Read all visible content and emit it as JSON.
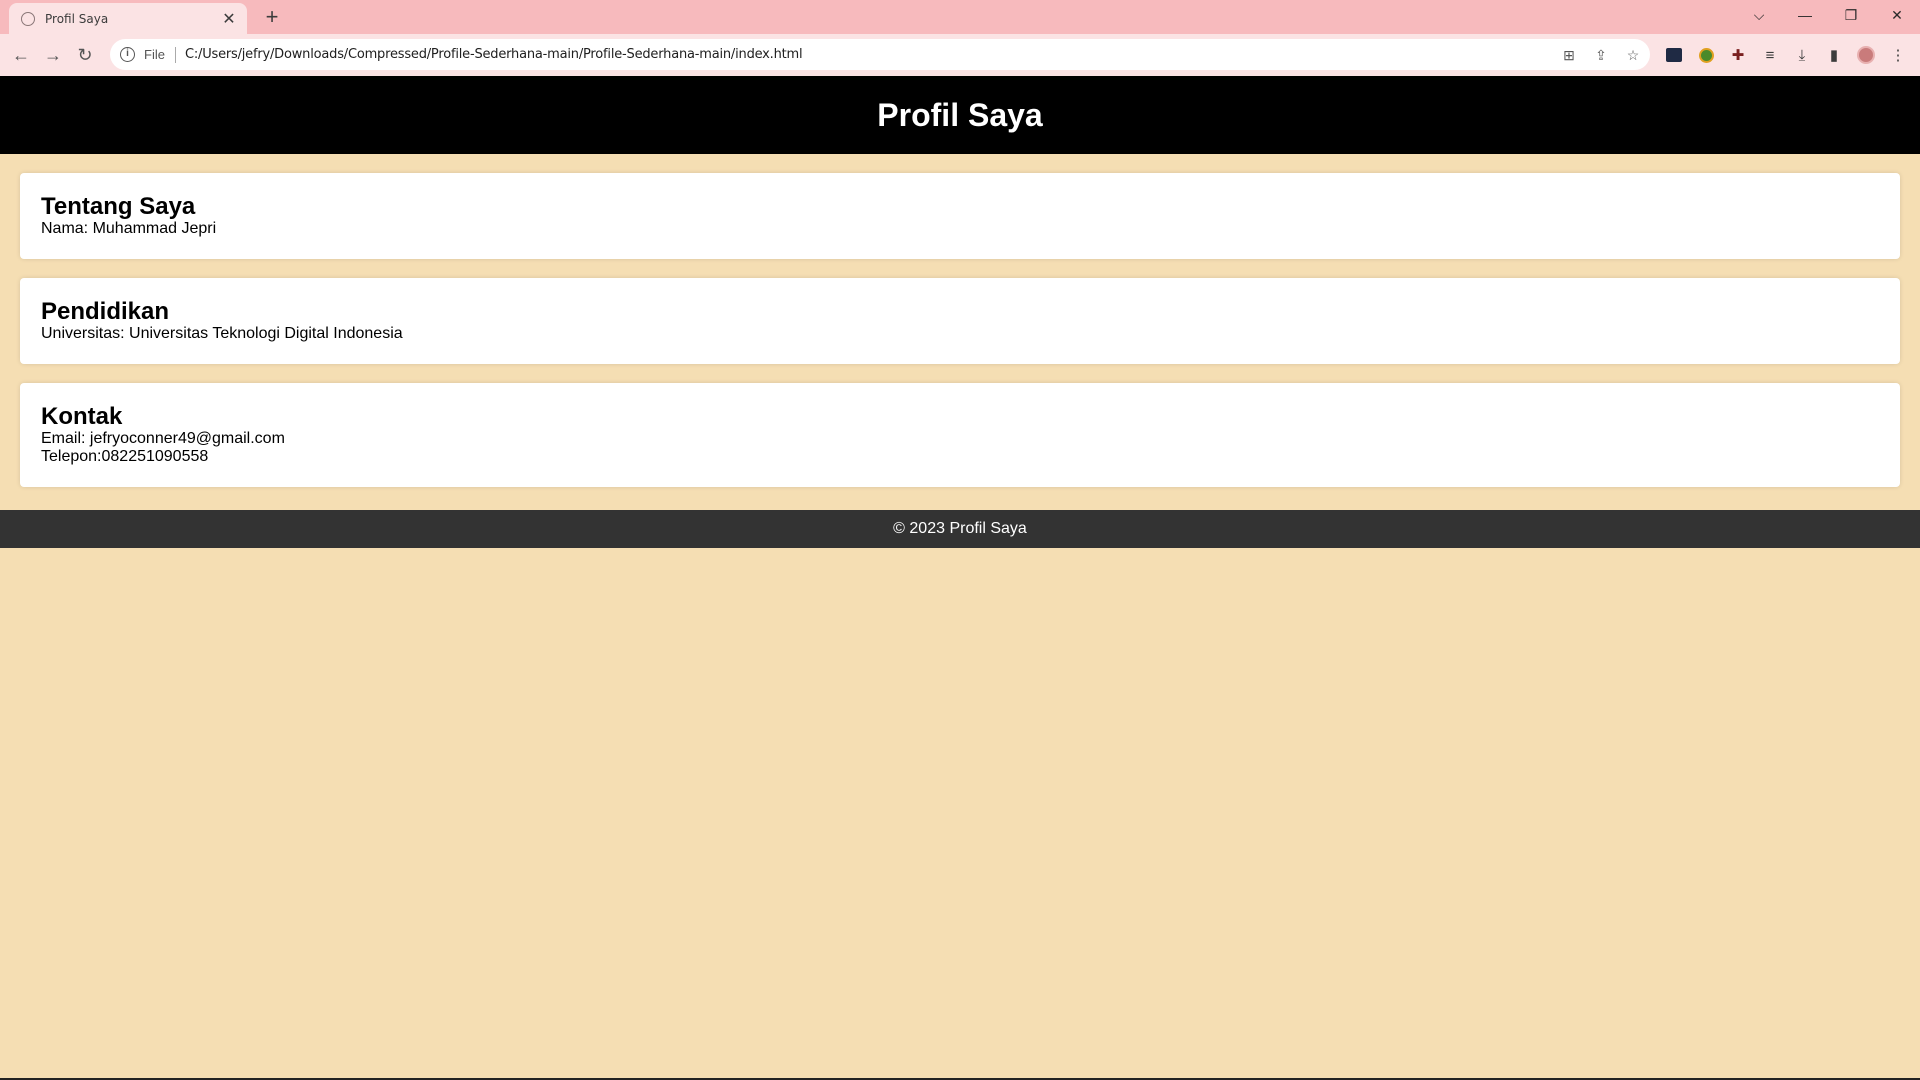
{
  "browser": {
    "tab_title": "Profil Saya",
    "address_scheme": "File",
    "address_url": "C:/Users/jefry/Downloads/Compressed/Profile-Sederhana-main/Profile-Sederhana-main/index.html",
    "colors": {
      "tabstrip": "#f7babd",
      "toolbar": "#fbe3e4"
    }
  },
  "page": {
    "header_title": "Profil Saya",
    "sections": [
      {
        "heading": "Tentang Saya",
        "lines": [
          "Nama: Muhammad Jepri"
        ]
      },
      {
        "heading": "Pendidikan",
        "lines": [
          "Universitas: Universitas Teknologi Digital Indonesia"
        ]
      },
      {
        "heading": "Kontak",
        "lines": [
          "Email: jefryoconner49@gmail.com",
          "Telepon:082251090558"
        ]
      }
    ],
    "footer_text": "© 2023 Profil Saya",
    "colors": {
      "background": "#f5deb3",
      "header": "#000000",
      "footer": "#333333"
    }
  }
}
